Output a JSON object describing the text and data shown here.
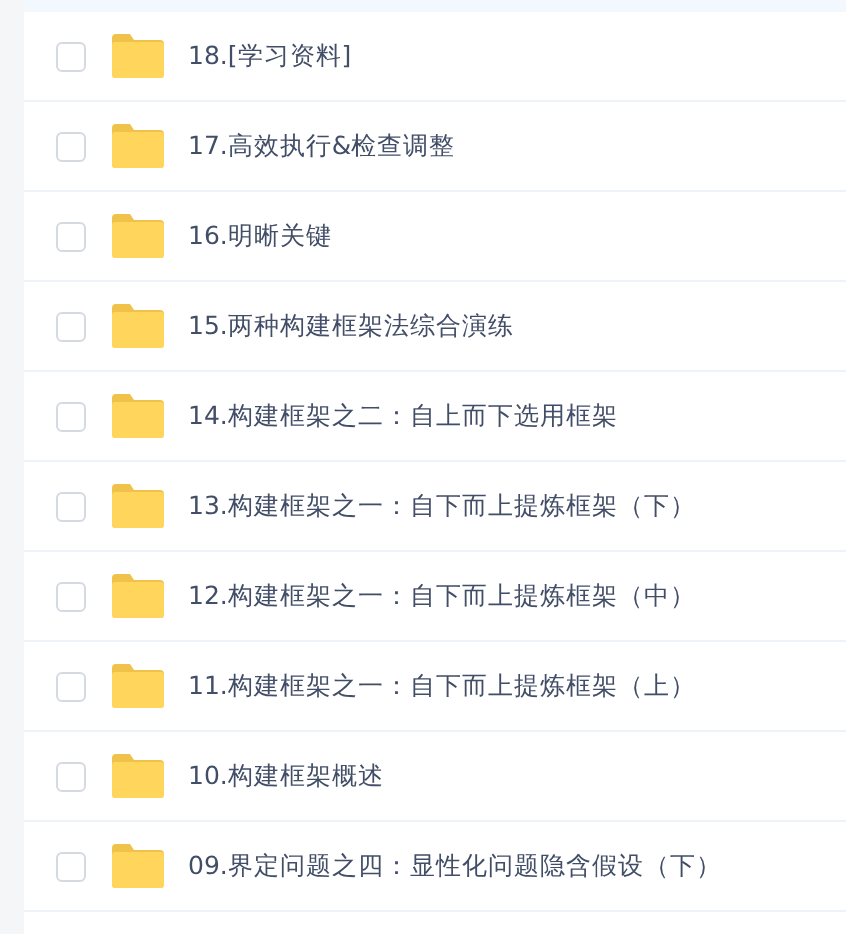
{
  "files": [
    {
      "name": "18.[学习资料]",
      "checked": false
    },
    {
      "name": "17.高效执行&检查调整",
      "checked": false
    },
    {
      "name": "16.明晰关键",
      "checked": false
    },
    {
      "name": "15.两种构建框架法综合演练",
      "checked": false
    },
    {
      "name": "14.构建框架之二：自上而下选用框架",
      "checked": false
    },
    {
      "name": "13.构建框架之一：自下而上提炼框架（下）",
      "checked": false
    },
    {
      "name": "12.构建框架之一：自下而上提炼框架（中）",
      "checked": false
    },
    {
      "name": "11.构建框架之一：自下而上提炼框架（上）",
      "checked": false
    },
    {
      "name": "10.构建框架概述",
      "checked": false
    },
    {
      "name": "09.界定问题之四：显性化问题隐含假设（下）",
      "checked": false
    }
  ]
}
